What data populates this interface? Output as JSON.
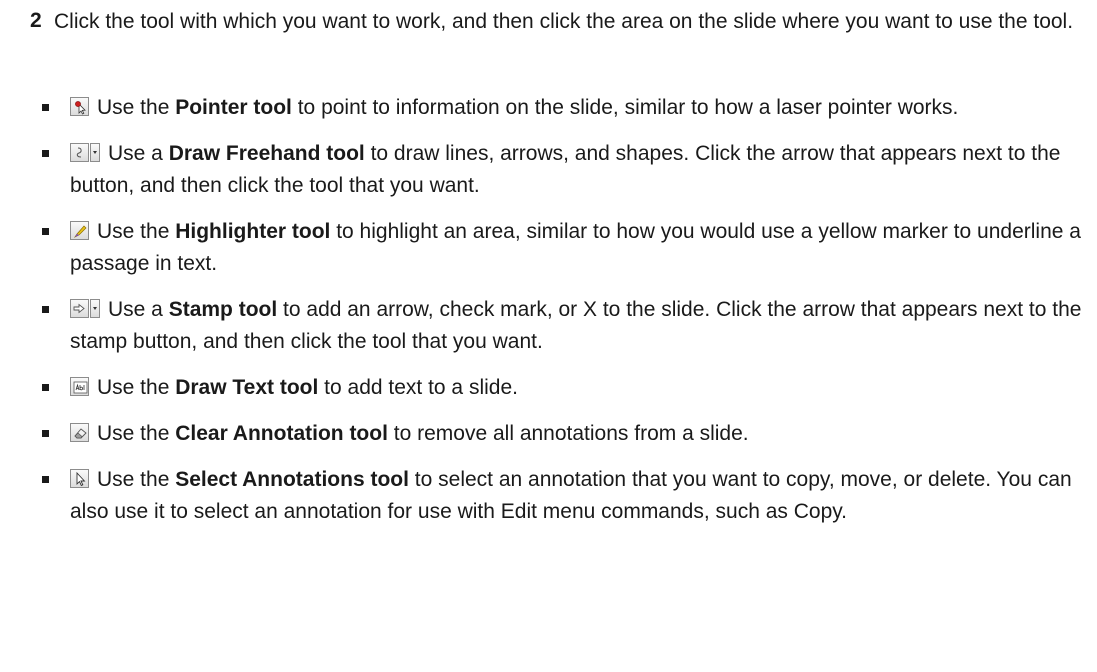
{
  "step": {
    "number": "2",
    "text": "Click the tool with which you want to work, and then click the area on the slide where you want to use the tool."
  },
  "items": [
    {
      "icon": "pointer-tool-icon",
      "pre": "Use the ",
      "bold": "Pointer tool",
      "post": " to point to information on the slide, similar to how a laser pointer works."
    },
    {
      "icon": "draw-freehand-tool-icon",
      "pre": "Use a ",
      "bold": "Draw Freehand tool",
      "post": " to draw lines, arrows, and shapes. Click the arrow that appears next to the button, and then click the tool that you want."
    },
    {
      "icon": "highlighter-tool-icon",
      "pre": "Use the ",
      "bold": "Highlighter tool",
      "post": " to highlight an area, similar to how you would use a yellow marker to underline a passage in text."
    },
    {
      "icon": "stamp-tool-icon",
      "pre": "Use a ",
      "bold": "Stamp tool",
      "post": " to add an arrow, check mark, or X to the slide. Click the arrow that appears next to the stamp button, and then click the tool that you want."
    },
    {
      "icon": "draw-text-tool-icon",
      "pre": "Use the ",
      "bold": "Draw Text tool",
      "post": " to add text to a slide."
    },
    {
      "icon": "clear-annotation-tool-icon",
      "pre": "Use the ",
      "bold": "Clear Annotation tool",
      "post": " to remove all annotations from a slide."
    },
    {
      "icon": "select-annotations-tool-icon",
      "pre": "Use the ",
      "bold": "Select Annotations tool",
      "post": " to select an annotation that you want to copy, move, or delete. You can also use it to select an annotation for use with Edit menu commands, such as Copy."
    }
  ],
  "icon_colors": {
    "pointer": "#cc1f1f",
    "highlighter": "#e8c21a",
    "button_border": "#8c8c8c"
  }
}
